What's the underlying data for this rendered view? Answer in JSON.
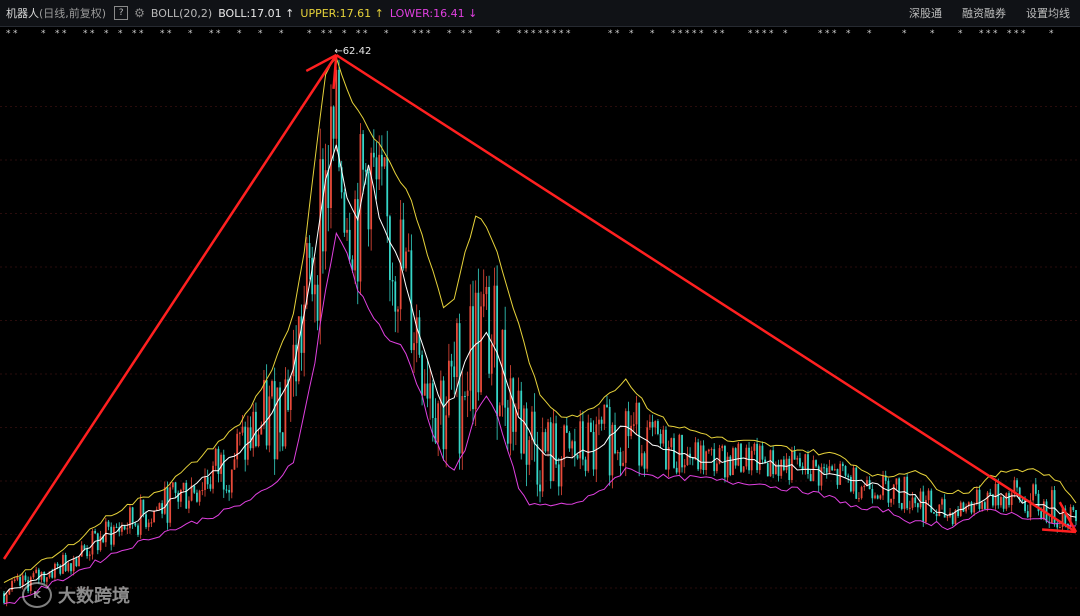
{
  "header": {
    "stock_name": "机器人",
    "adjust_mode": "(日线,前复权)",
    "help": "?",
    "indicator": "BOLL(20,2)",
    "boll": "BOLL:17.01 ↑",
    "upper": "UPPER:17.61 ↑",
    "lower": "LOWER:16.41 ↓",
    "links": [
      "深股通",
      "融资融券",
      "设置均线"
    ]
  },
  "colors": {
    "background": "#000000",
    "up_candle": "#e84a3a",
    "down_candle": "#35d6c8",
    "mid": "#ffffff",
    "upper": "#e6d23a",
    "lower": "#e040e0",
    "trend_arrows": "#ff2020",
    "grid": "#2a0c0c"
  },
  "chart_data": {
    "type": "line",
    "title": "",
    "xlabel": "",
    "ylabel": "",
    "ylim": [
      0,
      64
    ],
    "grid": true,
    "annotations": [
      {
        "text": "62.42",
        "label_text": "←62.42",
        "x": 31,
        "y": 62.42
      },
      {
        "text": "trend-up-arrow",
        "from": [
          0,
          6
        ],
        "to": [
          31,
          62
        ]
      },
      {
        "text": "trend-down-arrow",
        "from": [
          31,
          62
        ],
        "to": [
          100,
          9
        ]
      }
    ],
    "x": [
      0,
      5,
      10,
      15,
      20,
      22,
      25,
      27,
      28,
      29,
      30,
      31,
      32,
      33,
      34,
      35,
      36,
      37,
      38,
      39,
      40,
      41,
      42,
      43,
      44,
      45,
      46,
      47,
      48,
      49,
      50,
      52,
      54,
      55,
      56,
      58,
      60,
      62,
      65,
      68,
      70,
      72,
      75,
      78,
      80,
      82,
      85,
      87,
      88,
      90,
      92,
      94,
      96,
      98,
      100
    ],
    "series": [
      {
        "name": "MID",
        "values": [
          2.2,
          5,
          9,
          12,
          16,
          18,
          22,
          27,
          33,
          40,
          48,
          52,
          46,
          44,
          50,
          44,
          41,
          39,
          34,
          30,
          26,
          23,
          24,
          28,
          30,
          31,
          29,
          25,
          22,
          20,
          18,
          17,
          18,
          18,
          19,
          21,
          19,
          18,
          17,
          17,
          17,
          16.5,
          16,
          15,
          14.5,
          14,
          13,
          11,
          11,
          12,
          13,
          13,
          12,
          11.5,
          10.5
        ]
      },
      {
        "name": "UPPER",
        "values": [
          3.5,
          6.5,
          11,
          14,
          19,
          21,
          27,
          33,
          40,
          50,
          60,
          62,
          58,
          56,
          54,
          52,
          50,
          48,
          46,
          42,
          38,
          34,
          35,
          40,
          44,
          43,
          40,
          36,
          32,
          28,
          24,
          22,
          22,
          23,
          24,
          26,
          23,
          21,
          20,
          19,
          19,
          18.5,
          18,
          17.5,
          16,
          15,
          16,
          14,
          13.5,
          13.5,
          15,
          16,
          16,
          15,
          12.5
        ]
      },
      {
        "name": "LOWER",
        "values": [
          0.8,
          3.5,
          6.5,
          9,
          11,
          12,
          14,
          17,
          22,
          28,
          36,
          42,
          40,
          36,
          34,
          32,
          30,
          30,
          27,
          24,
          20,
          17,
          16,
          18,
          22,
          24,
          22,
          18,
          14,
          12,
          12,
          12,
          12.5,
          13,
          14,
          16,
          15.5,
          15,
          15,
          14.5,
          14.5,
          14,
          13.5,
          12.5,
          11.5,
          11.5,
          10,
          10,
          9.5,
          10.5,
          11.5,
          11,
          10.5,
          10,
          9.5
        ]
      }
    ]
  }
}
